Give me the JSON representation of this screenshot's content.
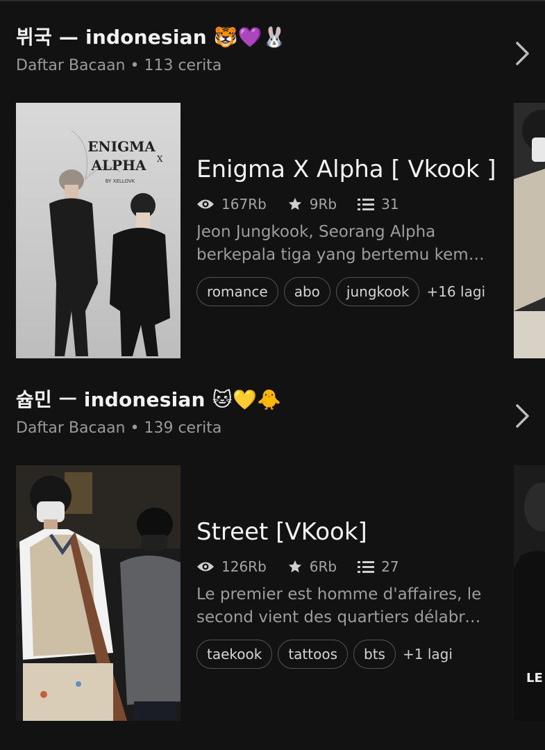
{
  "lists": [
    {
      "title": "뷔국 — indonesian 🐯💜🐰",
      "subtitle": "Daftar Bacaan • 113 cerita",
      "story": {
        "title": "Enigma X Alpha [ Vkook ]",
        "reads": "167Rb",
        "votes": "9Rb",
        "parts": "31",
        "desc_line1": "Jeon Jungkook, Seorang Alpha",
        "desc_line2": "berkepala tiga yang bertemu kemb...",
        "tags": [
          "romance",
          "abo",
          "jungkook"
        ],
        "more_tags": "+16 lagi",
        "cover_title_line1": "ENIGMA",
        "cover_title_line2": "ALPHA",
        "cover_title_x": "X",
        "cover_byline": "BY XELLOVK"
      }
    },
    {
      "title": "슙민 ㅡ indonesian 🐱💛🐥",
      "subtitle": "Daftar Bacaan • 139 cerita",
      "story": {
        "title": "Street [VKook]",
        "reads": "126Rb",
        "votes": "6Rb",
        "parts": "27",
        "desc_line1": "Le premier est homme d'affaires, le",
        "desc_line2": "second vient des quartiers délabré...",
        "tags": [
          "taekook",
          "tattoos",
          "bts"
        ],
        "more_tags": "+1 lagi",
        "peek_text": "LE"
      }
    }
  ],
  "colors": {
    "background": "#121212",
    "text": "#f4f4f4",
    "muted": "#9a9a9a",
    "tag_border": "#555555"
  }
}
